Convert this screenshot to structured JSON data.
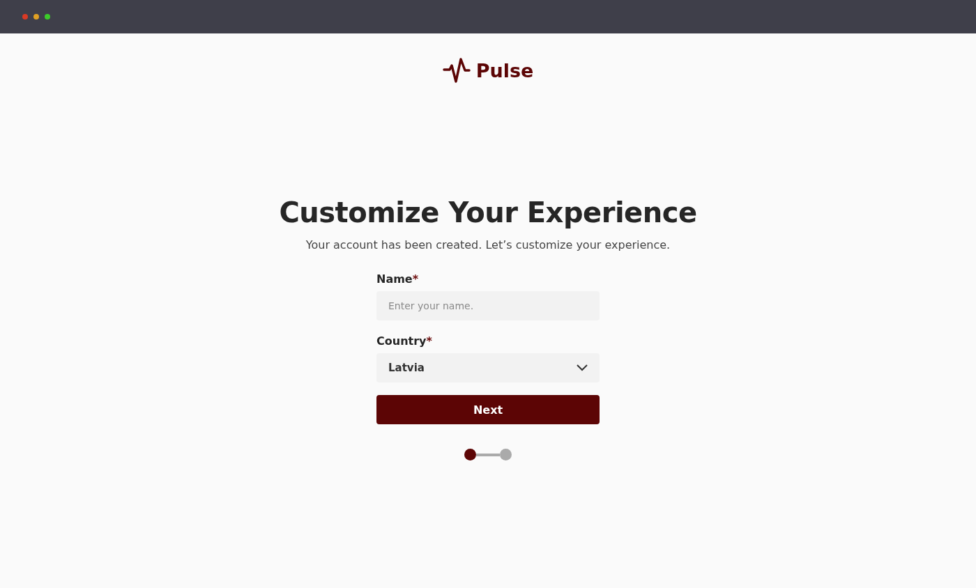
{
  "brand": {
    "name": "Pulse"
  },
  "heading": "Customize Your Experience",
  "subtitle": "Your account has been created. Let’s customize your experience.",
  "fields": [
    {
      "kind": "text",
      "label": "Name",
      "required_mark": "*",
      "placeholder": "Enter your name."
    },
    {
      "kind": "select",
      "label": "Country",
      "required_mark": "*",
      "value": "Latvia"
    }
  ],
  "button": "Next",
  "steps": [
    {
      "selected": true
    },
    {
      "selected": false
    }
  ]
}
